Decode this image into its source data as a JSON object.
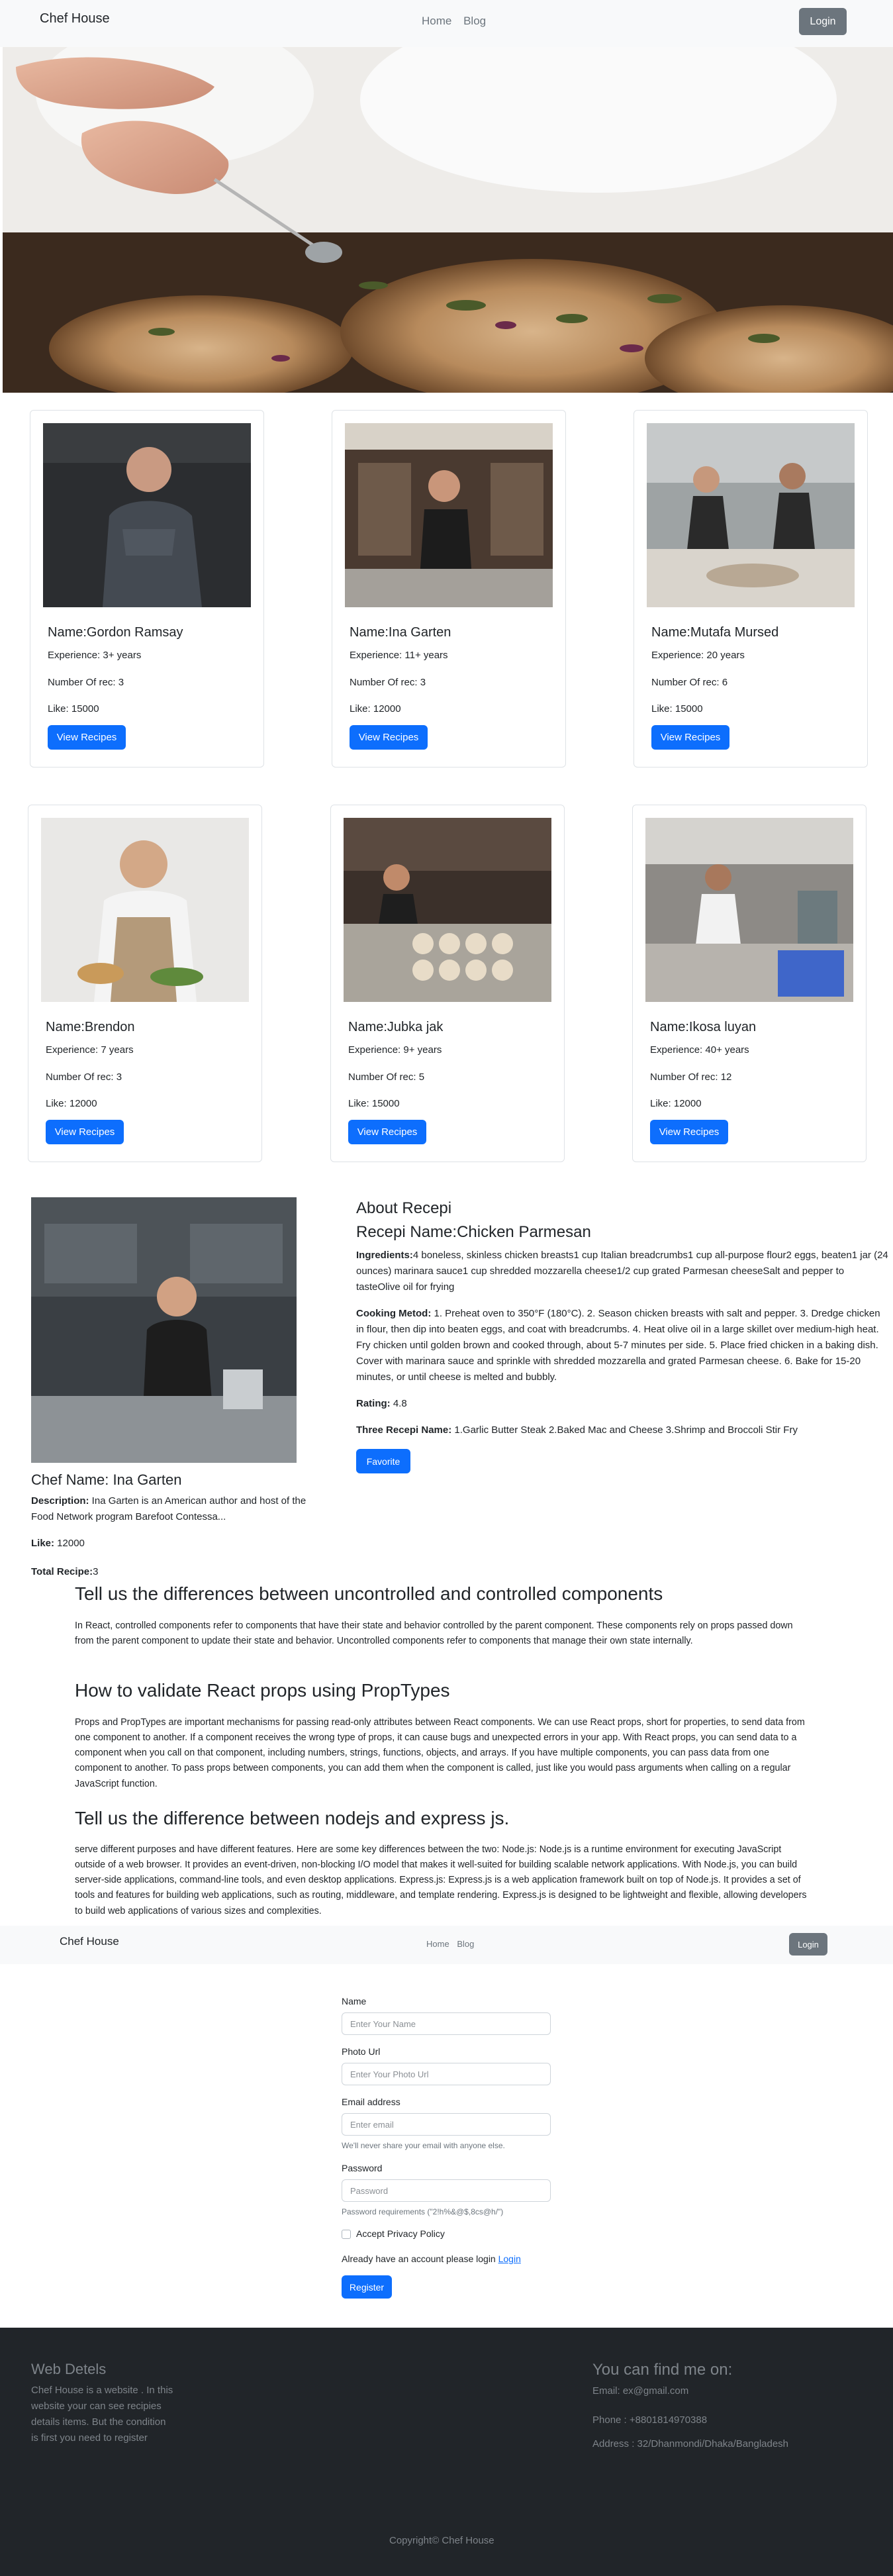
{
  "navbar": {
    "brand": "Chef House",
    "links": [
      "Home",
      "Blog"
    ],
    "login": "Login"
  },
  "chefs": [
    {
      "name": "Name:Gordon Ramsay",
      "experience": "Experience: 3+ years",
      "recipes": "Number Of rec: 3",
      "likes": "Like: 15000",
      "button": "View Recipes"
    },
    {
      "name": "Name:Ina Garten",
      "experience": "Experience: 11+ years",
      "recipes": "Number Of rec: 3",
      "likes": "Like: 12000",
      "button": "View Recipes"
    },
    {
      "name": "Name:Mutafa Mursed",
      "experience": "Experience: 20 years",
      "recipes": "Number Of rec: 6",
      "likes": "Like: 15000",
      "button": "View Recipes"
    },
    {
      "name": "Name:Brendon",
      "experience": "Experience: 7 years",
      "recipes": "Number Of rec: 3",
      "likes": "Like: 12000",
      "button": "View Recipes"
    },
    {
      "name": "Name:Jubka jak",
      "experience": "Experience: 9+ years",
      "recipes": "Number Of rec: 5",
      "likes": "Like: 15000",
      "button": "View Recipes"
    },
    {
      "name": "Name:Ikosa luyan",
      "experience": "Experience: 40+ years",
      "recipes": "Number Of rec: 12",
      "likes": "Like: 12000",
      "button": "View Recipes"
    }
  ],
  "detail": {
    "chef_name": "Chef Name: Ina Garten",
    "description_label": "Description:",
    "description": " Ina Garten is an American author and host of the Food Network program Barefoot Contessa...",
    "likes_label": "Like:",
    "likes": " 12000",
    "total_label": "Total Recipe:",
    "total": "3",
    "about_heading": "About Recepi",
    "recipe_name": "Recepi Name:Chicken Parmesan",
    "ingredients_label": "Ingredients:",
    "ingredients": "4 boneless, skinless chicken breasts1 cup Italian breadcrumbs1 cup all-purpose flour2 eggs, beaten1 jar (24 ounces) marinara sauce1 cup shredded mozzarella cheese1/2 cup grated Parmesan cheeseSalt and pepper to tasteOlive oil for frying",
    "method_label": "Cooking Metod:",
    "method": " 1. Preheat oven to 350°F (180°C). 2. Season chicken breasts with salt and pepper. 3. Dredge chicken in flour, then dip into beaten eggs, and coat with breadcrumbs. 4. Heat olive oil in a large skillet over medium-high heat. Fry chicken until golden brown and cooked through, about 5-7 minutes per side. 5. Place fried chicken in a baking dish. Cover with marinara sauce and sprinkle with shredded mozzarella and grated Parmesan cheese. 6. Bake for 15-20 minutes, or until cheese is melted and bubbly.",
    "rating_label": "Rating:",
    "rating": " 4.8",
    "three_label": "Three Recepi Name:",
    "three": " 1.Garlic Butter Steak 2.Baked Mac and Cheese 3.Shrimp and Broccoli Stir Fry",
    "favorite": "Favorite"
  },
  "blog": [
    {
      "heading": "Tell us the differences between uncontrolled and controlled components",
      "body": "In React, controlled components refer to components that have their state and behavior controlled by the parent component. These components rely on props passed down from the parent component to update their state and behavior. Uncontrolled components refer to components that manage their own state internally."
    },
    {
      "heading": "How to validate React props using PropTypes",
      "body": "Props and PropTypes are important mechanisms for passing read-only attributes between React components. We can use React props, short for properties, to send data from one component to another. If a component receives the wrong type of props, it can cause bugs and unexpected errors in your app. With React props, you can send data to a component when you call on that component, including numbers, strings, functions, objects, and arrays. If you have multiple components, you can pass data from one component to another. To pass props between components, you can add them when the component is called, just like you would pass arguments when calling on a regular JavaScript function."
    },
    {
      "heading": "Tell us the difference between nodejs and express js.",
      "body": "serve different purposes and have different features. Here are some key differences between the two: Node.js: Node.js is a runtime environment for executing JavaScript outside of a web browser. It provides an event-driven, non-blocking I/O model that makes it well-suited for building scalable network applications. With Node.js, you can build server-side applications, command-line tools, and even desktop applications. Express.js: Express.js is a web application framework built on top of Node.js. It provides a set of tools and features for building web applications, such as routing, middleware, and template rendering. Express.js is designed to be lightweight and flexible, allowing developers to build web applications of various sizes and complexities."
    }
  ],
  "form": {
    "name_label": "Name",
    "name_placeholder": "Enter Your Name",
    "photo_label": "Photo Url",
    "photo_placeholder": "Enter Your Photo Url",
    "email_label": "Email address",
    "email_placeholder": "Enter email",
    "email_help": "We'll never share your email with anyone else.",
    "password_label": "Password",
    "password_placeholder": "Password",
    "password_help": "Password requirements (\"2!h%&@$,8cs@h/\")",
    "privacy": "Accept Privacy Policy",
    "already": "Already have an account please login ",
    "login_link": "Login",
    "register": "Register"
  },
  "footer": {
    "web_title": "Web Detels",
    "web_text": "Chef House is a website . In this website your can see recipies details items. But the condition is first you need to register",
    "find_title": "You can find me on:",
    "email": "Email: ex@gmail.com",
    "phone": "Phone : +8801814970388",
    "address": "Address : 32/Dhanmondi/Dhaka/Bangladesh",
    "copyright": "Copyright© Chef House"
  },
  "colors": {
    "primary": "#0d6efd",
    "secondary": "#6c757d",
    "footer_bg": "#212529",
    "nav_bg": "#f8f9fa"
  },
  "icons": [
    "checkbox-icon"
  ]
}
